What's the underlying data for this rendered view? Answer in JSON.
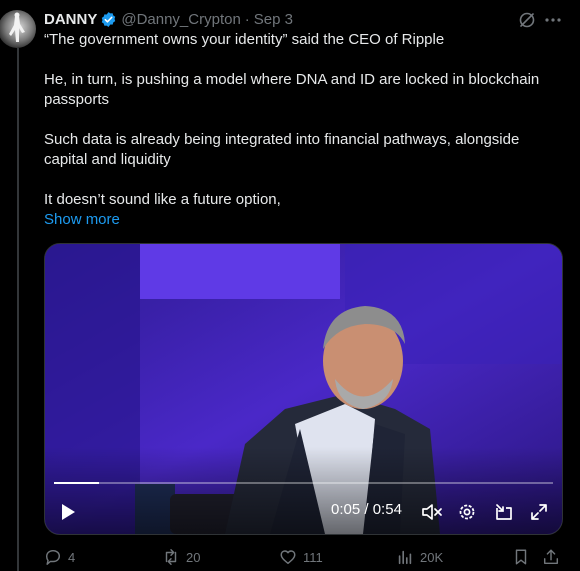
{
  "tweet": {
    "author_name": "DANNY",
    "handle": "@Danny_Crypton",
    "separator": "·",
    "date": "Sep 3",
    "paragraphs": [
      "“The government owns your identity” said the CEO of Ripple",
      "He, in turn, is pushing a model where DNA and ID are locked in blockchain passports",
      "Such data is already being integrated into financial pathways, alongside capital and liquidity",
      "It doesn’t sound like a future option,"
    ],
    "show_more": "Show more"
  },
  "video": {
    "current_time": "0:05",
    "time_separator": "/",
    "duration": "0:54",
    "progress_fraction": 0.09
  },
  "actions": {
    "replies": "4",
    "reposts": "20",
    "likes": "111",
    "views": "20K"
  },
  "icons": [
    "verified-badge-icon",
    "grok-icon",
    "more-icon",
    "play-icon",
    "mute-icon",
    "settings-icon",
    "pip-icon",
    "fullscreen-icon",
    "reply-icon",
    "repost-icon",
    "like-icon",
    "views-icon",
    "bookmark-icon",
    "share-icon"
  ],
  "colors": {
    "background": "#000000",
    "text": "#e7e9ea",
    "muted": "#71767b",
    "accent": "#1d9bf0",
    "video_bg": "#3a20b0"
  }
}
